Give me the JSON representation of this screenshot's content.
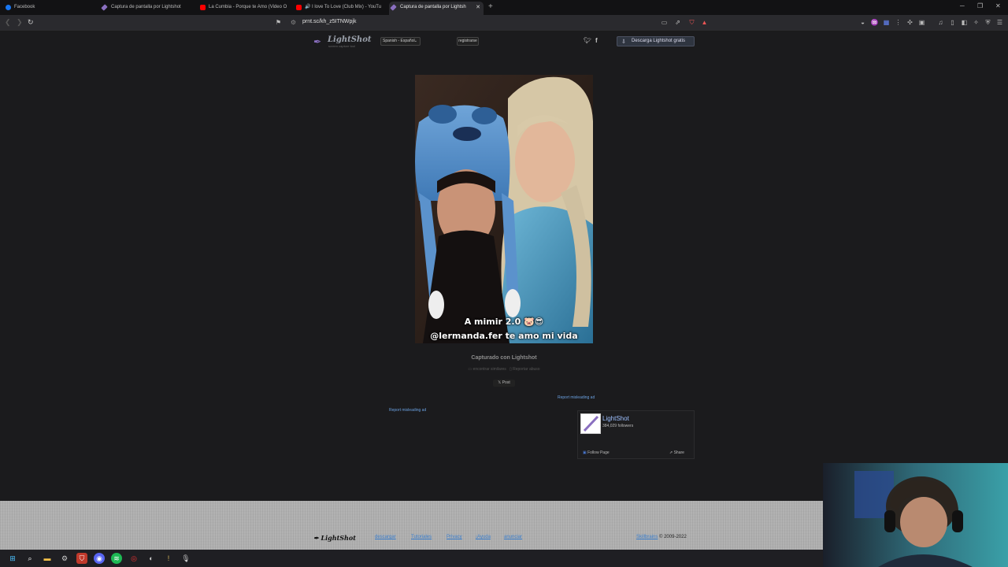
{
  "browser": {
    "tabs": [
      {
        "label": "Facebook",
        "icon": "facebook-icon",
        "color": "#1877f2"
      },
      {
        "label": "Captura de pantalla por Lightshot",
        "icon": "lightshot-feather-icon",
        "color": "#8a6fc0"
      },
      {
        "label": "La Cumbia - Porque te Amo (Video O",
        "icon": "youtube-icon",
        "color": "#ff0000"
      },
      {
        "label": "I love To Love (Club Mix) - YouTu",
        "icon": "youtube-icon",
        "color": "#ff0000"
      },
      {
        "label": "Captura de pantalla por Lightsh",
        "icon": "lightshot-feather-icon",
        "color": "#8a6fc0"
      }
    ],
    "url": "prnt.sc/kh_z5ITNWpjk"
  },
  "header": {
    "logo": "LightShot",
    "logo_sub": "screen capture tool",
    "language": "Spanish - Español",
    "register": "registrarse",
    "download": "Descarga Lightshot gratis"
  },
  "screenshot": {
    "caption_line1": "A mimir 2.0 🐷😎",
    "caption_line2": "@lermanda.fer te amo mi vida"
  },
  "below": {
    "captured": "Capturado con Lightshot",
    "find_similar": "encontrar similares",
    "report_abuse": "Reportar abuso",
    "post": "𝕏 Post"
  },
  "ads": {
    "report_left": "Report misleading ad",
    "report_right": "Report misleading ad"
  },
  "fb_widget": {
    "name": "LightShot",
    "followers": "384,029 followers",
    "follow": "Follow Page",
    "share": "Share"
  },
  "footer": {
    "logo": "LightShot",
    "links": [
      "descargar",
      "Tutoriales",
      "Privacy",
      "¡Ayuda",
      "anunciar"
    ],
    "company": "Skillbrains",
    "copyright": " © 2009-2022"
  },
  "colors": {
    "accent": "#6aa0e0",
    "brand": "#8a6fc0"
  }
}
